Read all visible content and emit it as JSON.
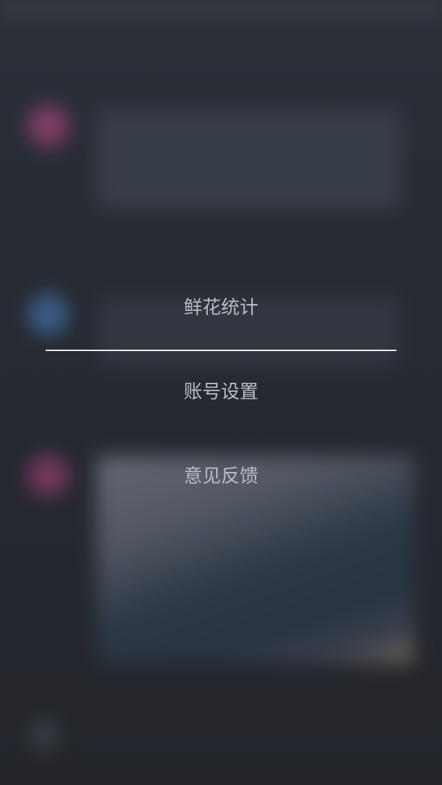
{
  "menu": {
    "items": [
      {
        "label": "鲜花统计"
      },
      {
        "label": "账号设置"
      },
      {
        "label": "意见反馈"
      }
    ]
  },
  "colors": {
    "overlay_background": "#262a32",
    "menu_text": "#b9bcc2",
    "divider": "#f2f2f2",
    "avatar_pink": "#8a3f6a",
    "avatar_blue": "#3d6290"
  }
}
